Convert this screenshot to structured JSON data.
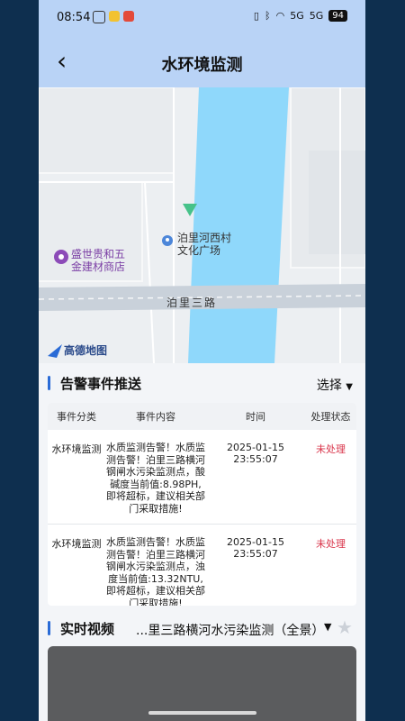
{
  "status": {
    "time": "08:54",
    "battery": "94",
    "signal_1": "5G",
    "signal_2": "5G"
  },
  "header": {
    "title": "水环境监测",
    "back_icon": "chevron-left-icon"
  },
  "map": {
    "poi_label_line1": "泊里河西村",
    "poi_label_line2": "文化广场",
    "shop_label_line1": "盛世贵和五",
    "shop_label_line2": "金建材商店",
    "road_label": "泊里三路",
    "logo_text": "高德地图",
    "colors": {
      "river": "#8fd8fb",
      "road": "#c9d1da",
      "ground": "#eceff2"
    }
  },
  "alerts": {
    "title": "告警事件推送",
    "select_label": "选择",
    "columns": [
      "事件分类",
      "事件内容",
      "时间",
      "处理状态"
    ],
    "rows": [
      {
        "category": "水环境监测",
        "content": "水质监测告警！水质监测告警！泊里三路横河钢闸水污染监测点，酸碱度当前值:8.98PH,即将超标，建议相关部门采取措施!",
        "time": "2025-01-15 23:55:07",
        "status": "未处理"
      },
      {
        "category": "水环境监测",
        "content": "水质监测告警！水质监测告警！泊里三路横河钢闸水污染监测点，浊度当前值:13.32NTU,即将超标，建议相关部门采取措施!",
        "time": "2025-01-15 23:55:07",
        "status": "未处理"
      }
    ]
  },
  "video": {
    "title": "实时视频",
    "source": "...里三路横河水污染监测（全景）"
  }
}
